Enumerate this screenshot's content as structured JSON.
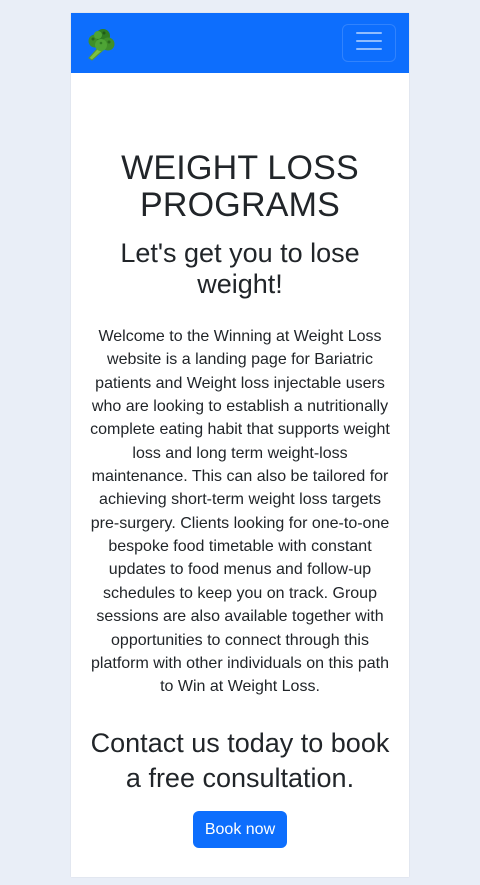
{
  "navbar": {
    "logo_icon": "broccoli-icon",
    "menu_icon": "hamburger-menu-icon",
    "bg_color": "#0d6efd"
  },
  "hero": {
    "title": "WEIGHT LOSS PROGRAMS",
    "subtitle": "Let's get you to lose weight!",
    "intro": "Welcome to the Winning at Weight Loss website is a landing page for Bariatric patients and Weight loss injectable users who are looking to establish a nutritionally complete eating habit that supports weight loss and long term weight-loss maintenance. This can also be tailored for achieving short-term weight loss targets pre-surgery. Clients looking for one-to-one bespoke food timetable with constant updates to food menus and follow-up schedules to keep you on track. Group sessions are also available together with opportunities to connect through this platform with other individuals on this path to Win at Weight Loss.",
    "contact": "Contact us today to book a free consultation.",
    "cta_label": "Book now"
  }
}
